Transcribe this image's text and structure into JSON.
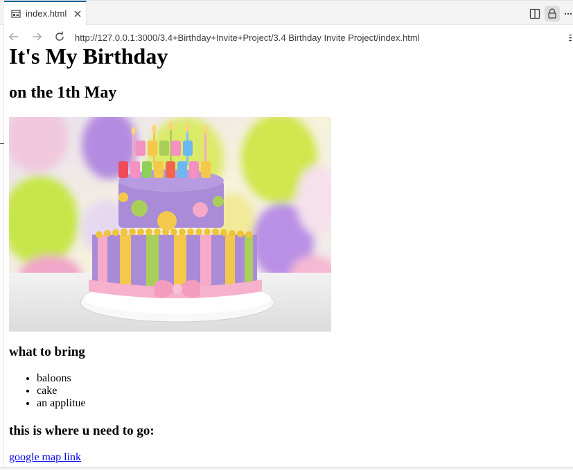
{
  "tab": {
    "title": "index.html",
    "icon": "preview-icon",
    "close_icon": "close-icon"
  },
  "toolbar": {
    "split_icon": "split-editor-icon",
    "lock_icon": "lock-icon",
    "more_icon": "more-actions-icon"
  },
  "nav": {
    "back_icon": "arrow-left-icon",
    "forward_icon": "arrow-right-icon",
    "reload_icon": "reload-icon",
    "url": "http://127.0.0.1:3000/3.4+Birthday+Invite+Project/3.4 Birthday Invite Project/index.html"
  },
  "page": {
    "heading": "It's My Birthday",
    "subheading": "on the 1th May",
    "bring_heading": "what to bring",
    "bring_items": [
      "baloons",
      "cake",
      "an applitue"
    ],
    "where_heading": "this is where u need to go:",
    "link_text": "google map link"
  },
  "colors": {
    "accent": "#0e639c",
    "link": "#0000ee",
    "cake_purple": "#9b7fd0",
    "cake_pink": "#f4a9c8",
    "cake_yellow": "#f3c84b",
    "cake_green": "#a9cf5a"
  }
}
